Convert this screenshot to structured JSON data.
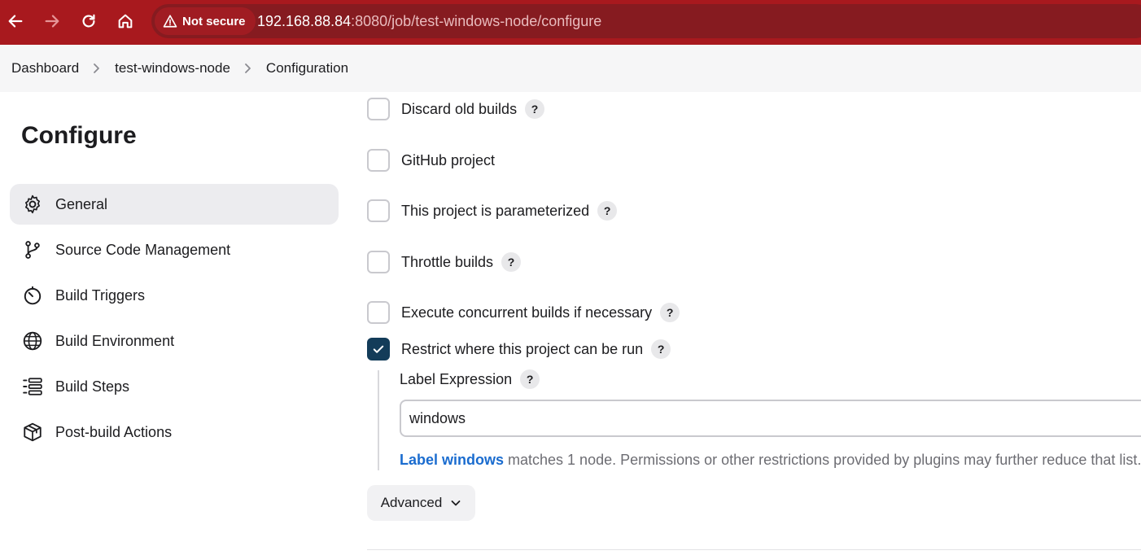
{
  "browser": {
    "security_label": "Not secure",
    "url_host": "192.168.88.84",
    "url_rest": ":8080/job/test-windows-node/configure"
  },
  "breadcrumb": [
    "Dashboard",
    "test-windows-node",
    "Configuration"
  ],
  "sidebar": {
    "title": "Configure",
    "items": [
      {
        "label": "General",
        "icon": "gear-icon",
        "active": true
      },
      {
        "label": "Source Code Management",
        "icon": "branch-icon"
      },
      {
        "label": "Build Triggers",
        "icon": "timer-icon"
      },
      {
        "label": "Build Environment",
        "icon": "globe-icon"
      },
      {
        "label": "Build Steps",
        "icon": "list-icon"
      },
      {
        "label": "Post-build Actions",
        "icon": "package-icon"
      }
    ]
  },
  "options": [
    {
      "label": "Discard old builds",
      "checked": false,
      "help": true
    },
    {
      "label": "GitHub project",
      "checked": false,
      "help": false
    },
    {
      "label": "This project is parameterized",
      "checked": false,
      "help": true
    },
    {
      "label": "Throttle builds",
      "checked": false,
      "help": true
    },
    {
      "label": "Execute concurrent builds if necessary",
      "checked": false,
      "help": true
    },
    {
      "label": "Restrict where this project can be run",
      "checked": true,
      "help": true
    }
  ],
  "restrict": {
    "field_label": "Label Expression",
    "value": "windows",
    "match_link": "Label windows",
    "match_text": " matches 1 node. Permissions or other restrictions provided by plugins may further reduce that list."
  },
  "help_glyph": "?",
  "advanced_label": "Advanced",
  "colors": {
    "chrome": "#a8191e",
    "checkbox_checked": "#133c59",
    "link": "#1a6ccf"
  }
}
